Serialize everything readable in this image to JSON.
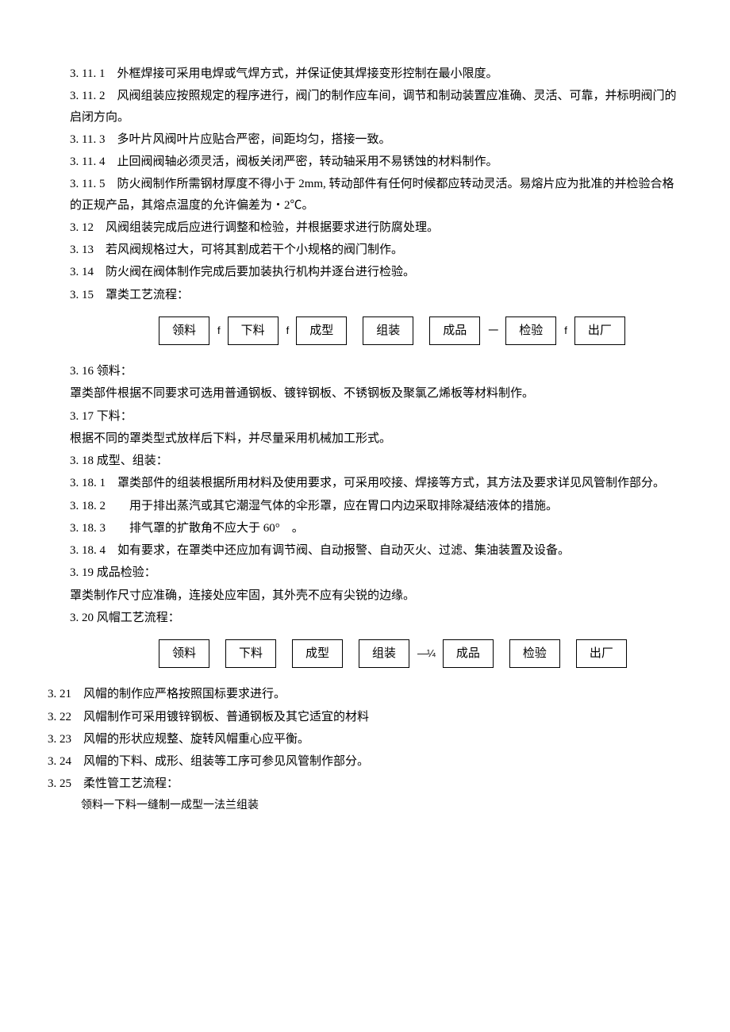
{
  "p": [
    "3. 11. 1　外框焊接可采用电焊或气焊方式，并保证使其焊接变形控制在最小限度。",
    "3. 11. 2　风阀组装应按照规定的程序进行，阀门的制作应车间，调节和制动装置应准确、灵活、可靠，并标明阀门的启闭方向。",
    "3. 11. 3　多叶片风阀叶片应贴合严密，间距均匀，搭接一致。",
    "3. 11. 4　止回阀阀轴必须灵活，阀板关闭严密，转动轴采用不易锈蚀的材料制作。",
    "3. 11. 5　防火阀制作所需钢材厚度不得小于 2mm, 转动部件有任何时候都应转动灵活。易熔片应为批准的并检验合格的正规产品，其熔点温度的允许偏差为・2℃。",
    "3. 12　风阀组装完成后应进行调整和检验，并根据要求进行防腐处理。",
    "3. 13　若风阀规格过大，可将其割成若干个小规格的阀门制作。",
    "3. 14　防火阀在阀体制作完成后要加装执行机构并逐台进行检验。",
    "3. 15　罩类工艺流程：",
    "3. 16 领料：",
    "罩类部件根据不同要求可选用普通钢板、镀锌钢板、不锈钢板及聚氯乙烯板等材料制作。",
    "3. 17 下料：",
    "根据不同的罩类型式放样后下料，并尽量采用机械加工形式。",
    "3. 18 成型、组装：",
    "3. 18. 1　罩类部件的组装根据所用材料及使用要求，可采用咬接、焊接等方式，其方法及要求详见风管制作部分。",
    "3. 18. 2　　用于排出蒸汽或其它潮湿气体的伞形罩，应在胃口内边采取排除凝结液体的措施。",
    "3. 18. 3　　排气罩的扩散角不应大于 60°　。",
    "3. 18. 4　如有要求，在罩类中还应加有调节阀、自动报警、自动灭火、过滤、集油装置及设备。",
    "3. 19 成品检验：",
    "罩类制作尺寸应准确，连接处应牢固，其外壳不应有尖锐的边缘。",
    "3. 20 风帽工艺流程：",
    "3. 21　风帽的制作应严格按照国标要求进行。",
    "3. 22　风帽制作可采用镀锌钢板、普通钢板及其它适宜的材料",
    "3. 23　风帽的形状应规整、旋转风帽重心应平衡。",
    "3. 24　风帽的下料、成形、组装等工序可参见风管制作部分。",
    "3. 25　柔性管工艺流程：",
    "领料一下料一缝制一成型一法兰组装"
  ],
  "flow1": {
    "steps": [
      "领料",
      "下料",
      "成型",
      "组装",
      "成品",
      "检验",
      "出厂"
    ],
    "arrows": [
      "f",
      "f",
      "",
      "",
      "一",
      "f",
      ""
    ]
  },
  "flow2": {
    "steps": [
      "领料",
      "下料",
      "成型",
      "组装",
      "成品",
      "检验",
      "出厂"
    ],
    "arrows": [
      "",
      "",
      "",
      "—¼",
      "",
      "",
      ""
    ]
  }
}
